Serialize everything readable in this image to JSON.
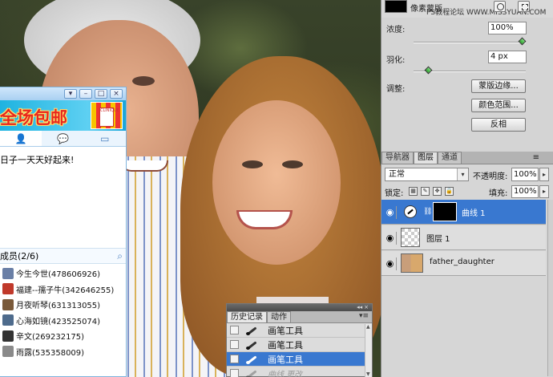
{
  "photoshop": {
    "mask_props": {
      "mask_label": "像素蒙版",
      "watermark": "PS教程论坛  WWW.MISSYUAN.COM",
      "density_label": "浓度:",
      "density_value": "100%",
      "density_level": 1.0,
      "feather_label": "羽化:",
      "feather_value": "4 px",
      "feather_level": 0.04,
      "adjust_label": "调整:",
      "buttons": {
        "mask_edge": "蒙版边缘...",
        "color_range": "颜色范围...",
        "invert": "反相"
      }
    },
    "layers_panel": {
      "tabs": [
        "导航器",
        "图层",
        "通道"
      ],
      "active_tab": "图层",
      "blend_mode": "正常",
      "opacity_label": "不透明度:",
      "opacity": "100%",
      "lock_label": "锁定:",
      "fill_label": "填充:",
      "fill": "100%",
      "layers": [
        {
          "name": "曲线 1",
          "selected": true
        },
        {
          "name": "图层 1",
          "selected": false
        },
        {
          "name": "father_daughter",
          "selected": false
        }
      ]
    },
    "history_panel": {
      "tabs": [
        "历史记录",
        "动作"
      ],
      "active_tab": "历史记录",
      "items": [
        {
          "label": "画笔工具",
          "selected": false
        },
        {
          "label": "画笔工具",
          "selected": false
        },
        {
          "label": "画笔工具",
          "selected": true
        },
        {
          "label": "曲线 更改",
          "selected": false,
          "dimmed": true
        }
      ]
    }
  },
  "chat": {
    "banner_text": "全场包邮",
    "motto": "日子一天天好起来!",
    "members_header": "成员(2/6)",
    "members": [
      {
        "label": "今生今世(478606926)",
        "color": "#6a7fa6"
      },
      {
        "label": "福建--孺子牛(342646255)",
        "color": "#c0392b"
      },
      {
        "label": "月夜听琴(631313055)",
        "color": "#7a5a3a"
      },
      {
        "label": "心海如镜(423525074)",
        "color": "#4e6b8c"
      },
      {
        "label": "辛文(269232175)",
        "color": "#333333"
      },
      {
        "label": "雨露(535358009)",
        "color": "#8a8a8a"
      }
    ]
  }
}
